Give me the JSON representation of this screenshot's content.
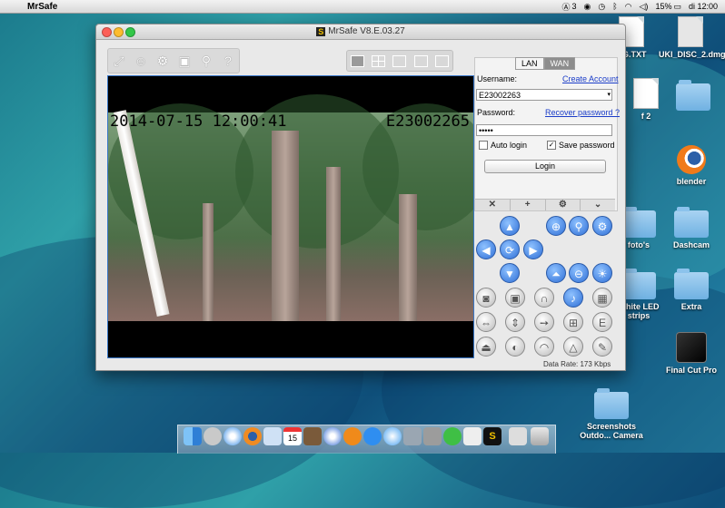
{
  "menubar": {
    "app_name": "MrSafe",
    "status_items": [
      "3",
      "15%",
      "di 12:00"
    ]
  },
  "desktop": {
    "icons": [
      {
        "label": "AG.TXT"
      },
      {
        "label": "UKI_DISC_2.dmg"
      },
      {
        "label": "f 2"
      },
      {
        "label": "blender"
      },
      {
        "label": "foto's"
      },
      {
        "label": "Dashcam"
      },
      {
        "label": "White LED strips"
      },
      {
        "label": "Extra"
      },
      {
        "label": "Final Cut Pro"
      },
      {
        "label": "Screenshots Outdo... Camera"
      },
      {
        "label": "TXT"
      }
    ]
  },
  "window": {
    "title": "MrSafe V8.E.03.27",
    "logo_text": "S"
  },
  "video": {
    "timestamp": "2014-07-15 12:00:41",
    "camera_id": "E23002265"
  },
  "login": {
    "tabs": [
      "LAN",
      "WAN"
    ],
    "active_tab": "WAN",
    "username_label": "Username:",
    "create_account": "Create Account",
    "username_value": "E23002263",
    "password_label": "Password:",
    "recover_password": "Recover password ?",
    "password_value": "•••••",
    "auto_login_label": "Auto login",
    "auto_login_checked": false,
    "save_password_label": "Save password",
    "save_password_checked": true,
    "login_button": "Login"
  },
  "account_bar": [
    "✕",
    "+",
    "⚙",
    "⌄"
  ],
  "status": {
    "data_rate": "Data Rate: 173 Kbps"
  },
  "colors": {
    "accent_blue": "#2f6fd6",
    "link_blue": "#1a3cc8",
    "video_border": "#3a78c8"
  }
}
